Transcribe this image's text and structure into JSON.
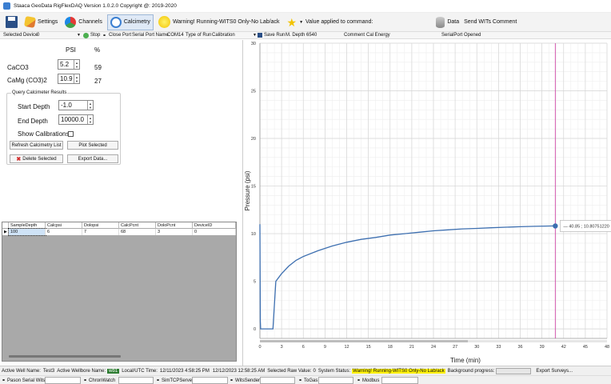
{
  "window": {
    "title": "Staaca GeoData RigFlexDAQ Version  1.0.2.0 Copyright @: 2019-2020"
  },
  "toolbar": {
    "settings": "Settings",
    "channels": "Channels",
    "calcimetry": "Calcimetry",
    "warning": "Warning! Running-WITS0 Only-No Lab/ack",
    "value_applied": "Value applied to command:",
    "data": "Data",
    "send_wits": "Send WITs Comment"
  },
  "statusrow": {
    "selected_device_label": "Selected Device",
    "selected_device_value": "0",
    "stop": "Stop",
    "close_port": "Close Port",
    "serial_port_name_label": "Serial Port Name",
    "serial_port_name_value": "COM14",
    "type_of_run_label": "Type of Run",
    "type_of_run_value": "Calibration",
    "save_run": "Save Run",
    "m_depth_label": "M. Depth",
    "m_depth_value": "6540",
    "comment_label": "Comment",
    "comment_value": "Cal Energy",
    "serial_port_status": "SerialPort Opened"
  },
  "calc": {
    "psi_header": "PSI",
    "pct_header": "%",
    "caco3_label": "CaCO3",
    "caco3_psi": "5.2",
    "caco3_pct": "59",
    "camg_label": "CaMg (CO3)2",
    "camg_psi": "10.9",
    "camg_pct": "27"
  },
  "query": {
    "group_title": "Query Calcimeter Results",
    "start_depth_label": "Start Depth",
    "start_depth_value": "-1.0",
    "end_depth_label": "End Depth",
    "end_depth_value": "10000.0",
    "show_calibrations_label": "Show Calibrations",
    "refresh_button": "Refresh Calcimetry List",
    "plot_button": "Plot Selected",
    "delete_button": "Delete Selected",
    "export_button": "Export Data..."
  },
  "table": {
    "columns": [
      "SampleDepth",
      "Calcpsi",
      "Dolopsi",
      "CalcPcnt",
      "DoloPcnt",
      "DeviceID"
    ],
    "rows": [
      [
        "100",
        "6",
        "7",
        "68",
        "3",
        "0"
      ]
    ]
  },
  "plot_labels": {
    "x_axis_title": "Time (min)",
    "y_axis_title": "Pressure (psi)",
    "tooltip": "40.85 ; 10.80751220"
  },
  "chart_data": {
    "type": "line",
    "xlabel": "Time (min)",
    "ylabel": "Pressure (psi)",
    "xlim": [
      0,
      48
    ],
    "ylim": [
      -1,
      30
    ],
    "x_ticks": [
      0,
      3,
      6,
      9,
      12,
      15,
      18,
      21,
      24,
      27,
      30,
      33,
      36,
      39,
      42,
      45,
      48
    ],
    "y_ticks": [
      0,
      5,
      10,
      15,
      20,
      25,
      30
    ],
    "grid": true,
    "line_color": "#3d6fb0",
    "cursor_color": "#d04aa8",
    "cursor_x": 40.85,
    "marker": {
      "x": 40.85,
      "y": 10.8075122
    },
    "series": [
      {
        "x": [
          0,
          0.05,
          0.1,
          0.5,
          1.5,
          1.8,
          2.0,
          2.2,
          3,
          4,
          5,
          6,
          8,
          10,
          12,
          14,
          16,
          18,
          20,
          22,
          24,
          26,
          28,
          30,
          32,
          34,
          36,
          38,
          40.85
        ],
        "y": [
          11,
          0.8,
          0,
          0,
          0,
          0,
          2.5,
          5.0,
          5.8,
          6.6,
          7.2,
          7.6,
          8.2,
          8.7,
          9.1,
          9.4,
          9.6,
          9.85,
          10.0,
          10.15,
          10.3,
          10.4,
          10.5,
          10.55,
          10.62,
          10.68,
          10.73,
          10.77,
          10.81
        ]
      }
    ]
  },
  "bottombar": {
    "active_well_label": "Active Well Name:",
    "active_well_value": "Test3",
    "active_wellbore_label": "Active Wellbore Name:",
    "active_wellbore_value": "wb1",
    "local_utc_label": "Local/UTC Time:",
    "local_time": "12/11/2023 4:58:25 PM",
    "utc_time": "12/12/2023 12:58:25 AM",
    "selected_raw_label": "Selected Raw Value:",
    "selected_raw_value": "0",
    "system_status_label": "System Status:",
    "system_status_value": "Warning! Running-WITS0 Only-No Lab/ack",
    "background_progress_label": "Background progress:",
    "export_surveys": "Export Surveys..."
  },
  "footer": {
    "pason": "Pason Serial Wits",
    "chrono": "ChronWatch",
    "sim": "SimTCPServer",
    "witssender": "WitsSender",
    "togas": "ToGas",
    "modbus": "Modbus"
  }
}
